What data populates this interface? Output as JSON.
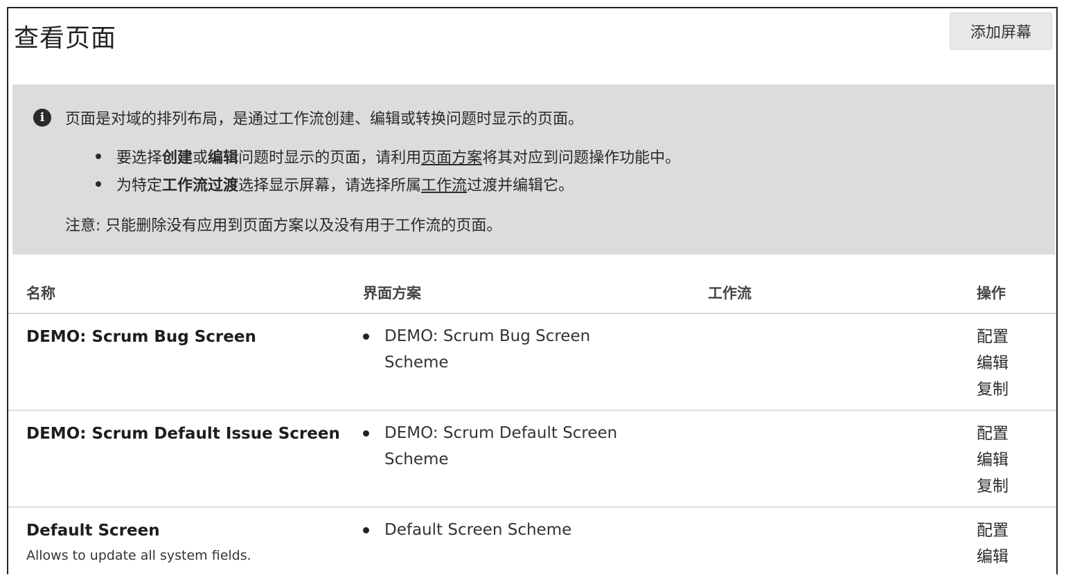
{
  "page": {
    "title": "查看页面",
    "add_button": "添加屏幕"
  },
  "info": {
    "icon": "info-icon",
    "main": "页面是对域的排列布局，是通过工作流创建、编辑或转换问题时显示的页面。",
    "bullet1": {
      "p1": "要选择",
      "b1": "创建",
      "p2": "或",
      "b2": "编辑",
      "p3": "问题时显示的页面，请利用",
      "link": "页面方案",
      "p4": "将其对应到问题操作功能中。"
    },
    "bullet2": {
      "p1": "为特定",
      "b1": "工作流过渡",
      "p2": "选择显示屏幕，请选择所属",
      "link": "工作流",
      "p3": "过渡并编辑它。"
    },
    "note": "注意: 只能删除没有应用到页面方案以及没有用于工作流的页面。"
  },
  "table": {
    "headers": [
      "名称",
      "界面方案",
      "工作流",
      "操作"
    ],
    "rows": [
      {
        "name": "DEMO: Scrum Bug Screen",
        "description": "",
        "scheme": "DEMO: Scrum Bug Screen Scheme",
        "workflow": "",
        "actions": [
          "配置",
          "编辑",
          "复制"
        ]
      },
      {
        "name": "DEMO: Scrum Default Issue Screen",
        "description": "",
        "scheme": "DEMO: Scrum Default Screen Scheme",
        "workflow": "",
        "actions": [
          "配置",
          "编辑",
          "复制"
        ]
      },
      {
        "name": "Default Screen",
        "description": "Allows to update all system fields.",
        "scheme": "Default Screen Scheme",
        "workflow": "",
        "actions": [
          "配置",
          "编辑"
        ]
      }
    ]
  }
}
